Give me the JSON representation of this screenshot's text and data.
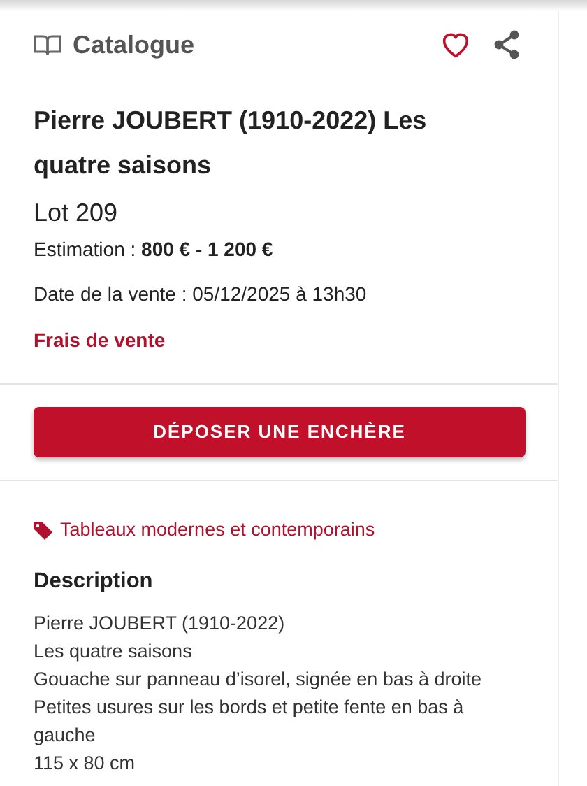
{
  "header": {
    "title": "Catalogue"
  },
  "lot": {
    "title": "Pierre JOUBERT (1910-2022) Les quatre saisons",
    "number": "Lot 209",
    "estimation": "Estimation : **800 € - 1 200 €**",
    "date": "Date de la vente : 05/12/2025 à 13h30",
    "fees_link": "Frais de vente"
  },
  "bid_button": "DÉPOSER UNE ENCHÈRE",
  "category": "Tableaux modernes et contemporains",
  "description": {
    "heading": "Description",
    "lines": [
      "Pierre JOUBERT (1910-2022)",
      "Les quatre saisons",
      "Gouache sur panneau d’isorel, signée en bas à droite",
      "Petites usures sur les bords et petite fente en bas à gauche",
      "115 x 80 cm"
    ]
  }
}
